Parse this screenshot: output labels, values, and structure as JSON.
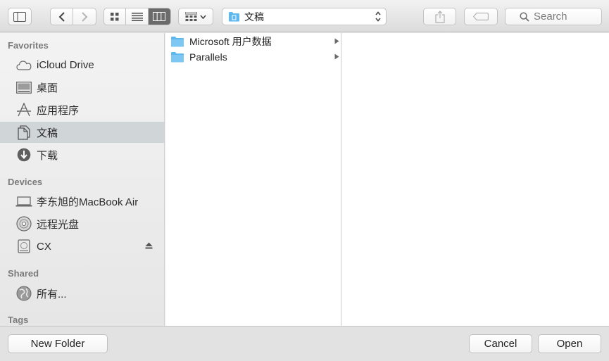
{
  "toolbar": {
    "path_label": "文稿",
    "search_placeholder": "Search"
  },
  "sidebar": {
    "sections": {
      "favorites": "Favorites",
      "devices": "Devices",
      "shared": "Shared",
      "tags": "Tags"
    },
    "favorites": [
      {
        "label": "iCloud Drive",
        "icon": "cloud-icon"
      },
      {
        "label": "桌面",
        "icon": "desktop-icon"
      },
      {
        "label": "应用程序",
        "icon": "applications-icon"
      },
      {
        "label": "文稿",
        "icon": "documents-icon",
        "selected": true
      },
      {
        "label": "下载",
        "icon": "downloads-icon"
      }
    ],
    "devices": [
      {
        "label": "李东旭的MacBook Air",
        "icon": "laptop-icon"
      },
      {
        "label": "远程光盘",
        "icon": "remote-disc-icon"
      },
      {
        "label": "CX",
        "icon": "drive-icon"
      }
    ],
    "shared": [
      {
        "label": "所有...",
        "icon": "network-globe-icon"
      }
    ]
  },
  "browser": {
    "column1": [
      {
        "label": "Microsoft 用户数据",
        "icon": "folder-icon"
      },
      {
        "label": "Parallels",
        "icon": "folder-icon"
      }
    ]
  },
  "buttons": {
    "new_folder": "New Folder",
    "cancel": "Cancel",
    "open": "Open"
  },
  "colors": {
    "folder_blue": "#5db8ef",
    "selected_sidebar": "#d0d5d8",
    "active_segment": "#6b6b6b"
  }
}
